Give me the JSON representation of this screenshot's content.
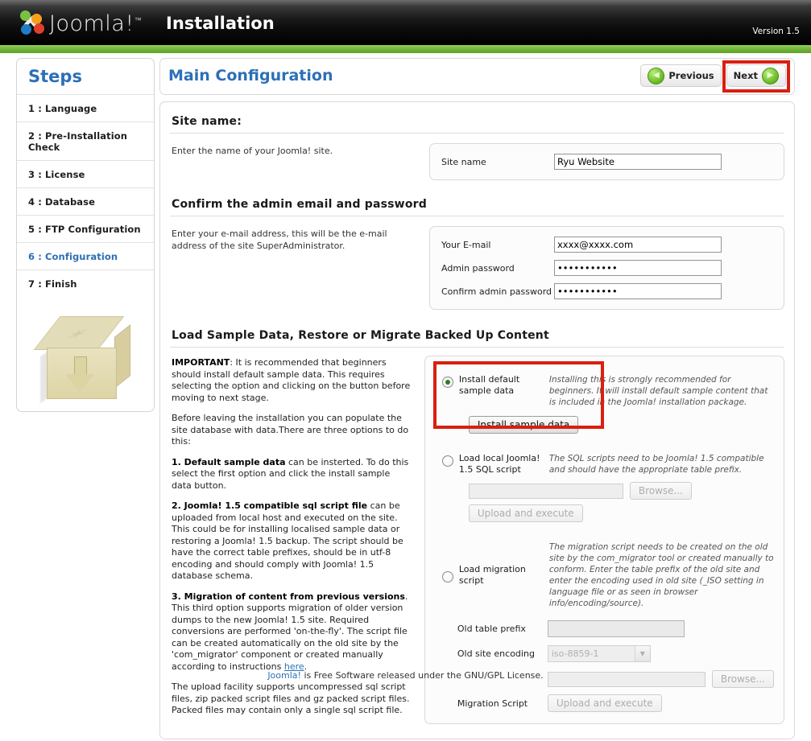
{
  "header": {
    "logo_text": "Joomla!",
    "logo_tm": "™",
    "title": "Installation",
    "version": "Version 1.5"
  },
  "sidebar": {
    "title": "Steps",
    "steps": [
      {
        "label": "1 : Language",
        "active": false
      },
      {
        "label": "2 : Pre-Installation Check",
        "active": false
      },
      {
        "label": "3 : License",
        "active": false
      },
      {
        "label": "4 : Database",
        "active": false
      },
      {
        "label": "5 : FTP Configuration",
        "active": false
      },
      {
        "label": "6 : Configuration",
        "active": true
      },
      {
        "label": "7 : Finish",
        "active": false
      }
    ]
  },
  "main": {
    "page_title": "Main Configuration",
    "previous_label": "Previous",
    "next_label": "Next",
    "site_name_section": {
      "heading": "Site name:",
      "description": "Enter the name of your Joomla! site.",
      "field_label": "Site name",
      "field_value": "Ryu Website"
    },
    "admin_section": {
      "heading": "Confirm the admin email and password",
      "description": "Enter your e-mail address, this will be the e-mail address of the site SuperAdministrator.",
      "email_label": "Your E-mail",
      "email_value": "xxxx@xxxx.com",
      "password_label": "Admin password",
      "password_value": "•••••••••••",
      "confirm_label": "Confirm admin password",
      "confirm_value": "•••••••••••"
    },
    "sample_section": {
      "heading": "Load Sample Data, Restore or Migrate Backed Up Content",
      "paragraphs": {
        "p1_bold": "IMPORTANT",
        "p1_rest": ": It is recommended that beginners should install default sample data. This requires selecting the option and clicking on the button before moving to next stage.",
        "p2": "Before leaving the installation you can populate the site database with data.There are three options to do this:",
        "p3_bold": "1. Default sample data",
        "p3_rest": " can be insterted. To do this select the first option and click the install sample data button.",
        "p4_bold": "2. Joomla! 1.5 compatible sql script file",
        "p4_rest": " can be uploaded from local host and executed on the site. This could be for installing localised sample data or restoring a Joomla! 1.5 backup. The script should be have the correct table prefixes, should be in utf-8 encoding and should comply with Joomla! 1.5 database schema.",
        "p5_bold": "3. Migration of content from previous versions",
        "p5_rest": ". This third option supports migration of older version dumps to the new Joomla! 1.5 site. Required conversions are performed 'on-the-fly'. The script file can be created automatically on the old site by the 'com_migrator' component or created manually according to instructions ",
        "p5_link": "here",
        "p5_end": ".",
        "p6": "The upload facility supports uncompressed sql script files, zip packed script files and gz packed script files. Packed files may contain only a single sql script file."
      },
      "option1": {
        "label": "Install default sample data",
        "description": "Installing this is strongly recommended for beginners. It will install default sample content that is included in the Joomla! installation package.",
        "button_label": "Install sample data",
        "selected": true
      },
      "option2": {
        "label": "Load local Joomla! 1.5 SQL script",
        "description": "The SQL scripts need to be Joomla! 1.5 compatible and should have the appropriate table prefix.",
        "file_value": "",
        "browse_label": "Browse...",
        "upload_label": "Upload and execute",
        "selected": false
      },
      "option3": {
        "label": "Load migration script",
        "description": "The migration script needs to be created on the old site by the com_migrator tool or created manually to conform. Enter the table prefix of the old site and enter the encoding used in old site (_ISO setting in language file or as seen in browser info/encoding/source).",
        "prefix_label": "Old table prefix",
        "prefix_value": "",
        "encoding_label": "Old site encoding",
        "encoding_value": "iso-8859-1",
        "script_label": "Migration Script",
        "file_value": "",
        "browse_label": "Browse...",
        "upload_label": "Upload and execute",
        "selected": false
      }
    }
  },
  "footer": {
    "link": "Joomla!",
    "text": " is Free Software released under the GNU/GPL License."
  },
  "colors": {
    "brand_blue": "#2d6fb7",
    "accent_green": "#6cb033",
    "highlight_red": "#d91f11"
  }
}
